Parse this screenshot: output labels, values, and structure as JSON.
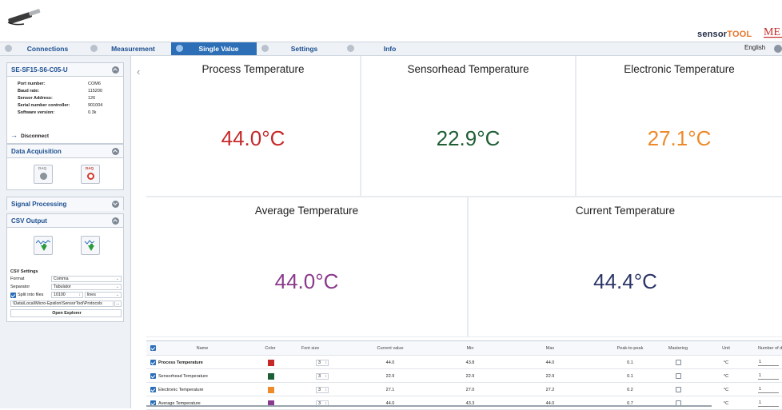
{
  "header": {
    "brand_part1": "sensor",
    "brand_part2": "TOOL",
    "logo_text": "ME"
  },
  "nav": {
    "tabs": [
      {
        "label": "Connections",
        "active": false
      },
      {
        "label": "Measurement",
        "active": false
      },
      {
        "label": "Single Value",
        "active": true
      },
      {
        "label": "Settings",
        "active": false
      },
      {
        "label": "Info",
        "active": false
      }
    ],
    "language": "English"
  },
  "sensor_panel": {
    "title": "SE-SF15-S6-C05-U",
    "rows": [
      {
        "key": "Port number:",
        "value": "COM6"
      },
      {
        "key": "Baud rate:",
        "value": "115200"
      },
      {
        "key": "Sensor Address:",
        "value": "126"
      },
      {
        "key": "Serial number controller:",
        "value": "901004"
      },
      {
        "key": "Software version:",
        "value": "0.3k"
      }
    ],
    "disconnect_label": "Disconnect"
  },
  "data_acquisition": {
    "title": "Data Acquisition",
    "btn_caption": "DAQ"
  },
  "signal_processing": {
    "title": "Signal Processing"
  },
  "csv_output": {
    "title": "CSV Output",
    "settings_label": "CSV Settings",
    "format_label": "Format",
    "format_value": "Comma",
    "separator_label": "Separator",
    "separator_value": "Tabulator",
    "split_label": "Split into files",
    "split_count": "10100",
    "split_unit": "lines",
    "path": "\\Data\\Local\\Micro-Epsilon\\SensorTool\\Protocols",
    "browse_label": "...",
    "open_explorer": "Open Explorer"
  },
  "tiles": [
    {
      "title": "Process Temperature",
      "value": "44.0°C",
      "color": "#c62828"
    },
    {
      "title": "Sensorhead Temperature",
      "value": "22.9°C",
      "color": "#1e5e34"
    },
    {
      "title": "Electronic Temperature",
      "value": "27.1°C",
      "color": "#ee8a2a"
    },
    {
      "title": "Average Temperature",
      "value": "44.0°C",
      "color": "#8a3a8c"
    },
    {
      "title": "Current Temperature",
      "value": "44.4°C",
      "color": "#2b3566"
    }
  ],
  "table": {
    "headers": [
      "Name",
      "Color",
      "Font size",
      "Current value",
      "Min",
      "Max",
      "Peak-to-peak",
      "Mastering",
      "Unit",
      "Number of di"
    ],
    "rows": [
      {
        "name": "Process Temperature",
        "color": "#c62828",
        "font_size": "3",
        "current": "44.0",
        "min": "43.8",
        "max": "44.0",
        "p2p": "0.1",
        "unit": "°C",
        "digits": "1"
      },
      {
        "name": "Sensorhead Temperature",
        "color": "#1e5e34",
        "font_size": "3",
        "current": "22.9",
        "min": "22.9",
        "max": "22.9",
        "p2p": "0.1",
        "unit": "°C",
        "digits": "1"
      },
      {
        "name": "Electronic Temperature",
        "color": "#ee8a2a",
        "font_size": "3",
        "current": "27.1",
        "min": "27.0",
        "max": "27.2",
        "p2p": "0.2",
        "unit": "°C",
        "digits": "1"
      },
      {
        "name": "Average Temperature",
        "color": "#8a3a8c",
        "font_size": "3",
        "current": "44.0",
        "min": "43.3",
        "max": "44.0",
        "p2p": "0.7",
        "unit": "°C",
        "digits": "1"
      }
    ]
  }
}
